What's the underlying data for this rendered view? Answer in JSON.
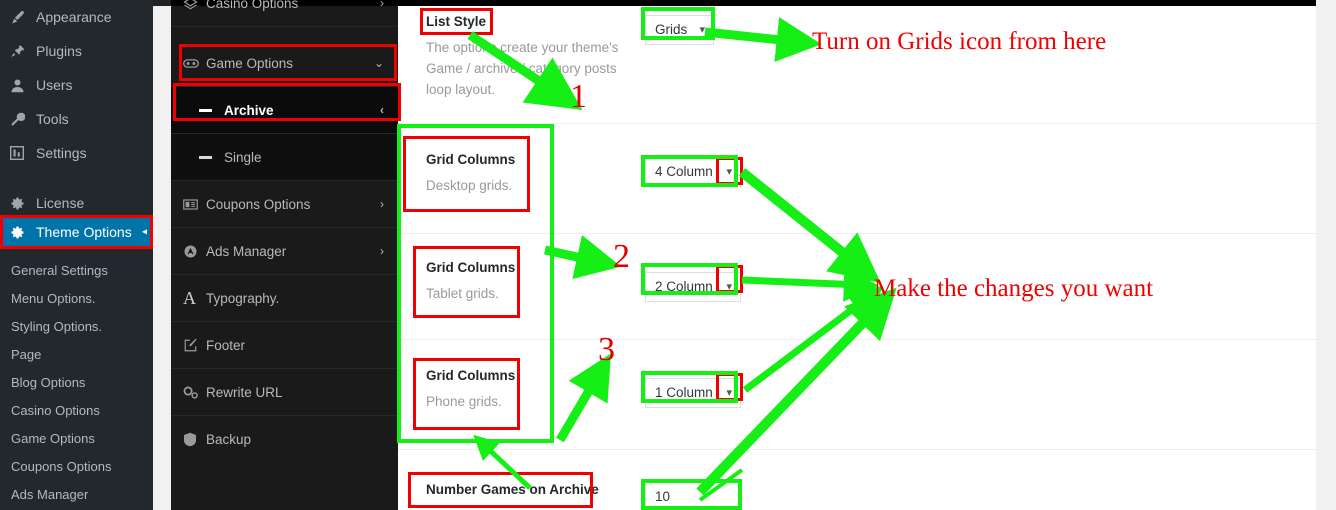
{
  "wp_menu": {
    "items": [
      {
        "label": "Appearance",
        "icon": "brush-icon",
        "current": false
      },
      {
        "label": "Plugins",
        "icon": "plug-icon",
        "current": false
      },
      {
        "label": "Users",
        "icon": "user-icon",
        "current": false
      },
      {
        "label": "Tools",
        "icon": "wrench-icon",
        "current": false
      },
      {
        "label": "Settings",
        "icon": "settings-sliders-icon",
        "current": false
      },
      {
        "label": "License",
        "icon": "gear-icon",
        "current": false
      },
      {
        "label": "Theme Options",
        "icon": "gear-icon",
        "current": true
      }
    ],
    "submenu": [
      "General Settings",
      "Menu Options.",
      "Styling Options.",
      "Page",
      "Blog Options",
      "Casino Options",
      "Game Options",
      "Coupons Options",
      "Ads Manager"
    ]
  },
  "options_nav": {
    "items": [
      {
        "label": "Casino Options",
        "icon": "casino-chip-icon",
        "chevron": "›",
        "type": "top",
        "active": false
      },
      {
        "label": "Game Options",
        "icon": "gamepad-icon",
        "chevron": "⌄",
        "type": "top",
        "active": false
      },
      {
        "label": "Archive",
        "icon": "dash-icon",
        "chevron": "‹",
        "type": "sub",
        "active": true
      },
      {
        "label": "Single",
        "icon": "dash-icon",
        "chevron": "",
        "type": "sub",
        "active": false
      },
      {
        "label": "Coupons Options",
        "icon": "coupon-icon",
        "chevron": "›",
        "type": "top",
        "active": false
      },
      {
        "label": "Ads Manager",
        "icon": "ads-icon",
        "chevron": "›",
        "type": "top",
        "active": false
      },
      {
        "label": "Typography.",
        "icon": "typography-a-icon",
        "chevron": "",
        "type": "top",
        "active": false
      },
      {
        "label": "Footer",
        "icon": "edit-square-icon",
        "chevron": "",
        "type": "top",
        "active": false
      },
      {
        "label": "Rewrite URL",
        "icon": "cogs-icon",
        "chevron": "",
        "type": "top",
        "active": false
      },
      {
        "label": "Backup",
        "icon": "shield-icon",
        "chevron": "",
        "type": "top",
        "active": false
      }
    ]
  },
  "fields": {
    "list_style": {
      "title": "List Style",
      "desc": "The options create your theme's Game / archive / category posts loop layout.",
      "value": "Grids",
      "chevron": "⌄"
    },
    "grid_desktop": {
      "title": "Grid Columns",
      "desc": "Desktop grids.",
      "value": "4 Column",
      "chevron": "⌄"
    },
    "grid_tablet": {
      "title": "Grid Columns",
      "desc": "Tablet grids.",
      "value": "2 Column",
      "chevron": "⌄"
    },
    "grid_phone": {
      "title": "Grid Columns",
      "desc": "Phone grids.",
      "value": "1 Column",
      "chevron": "⌄"
    },
    "number_games": {
      "title": "Number Games on Archive",
      "value": "10"
    }
  },
  "annotations": {
    "step1": "1",
    "step2": "2",
    "step3": "3",
    "note_grids": "Turn on Grids icon from here",
    "note_changes": "Make the changes you want",
    "colors": {
      "red": "#f20000",
      "green": "#15ef15",
      "accent_blue": "#0073aa"
    }
  }
}
